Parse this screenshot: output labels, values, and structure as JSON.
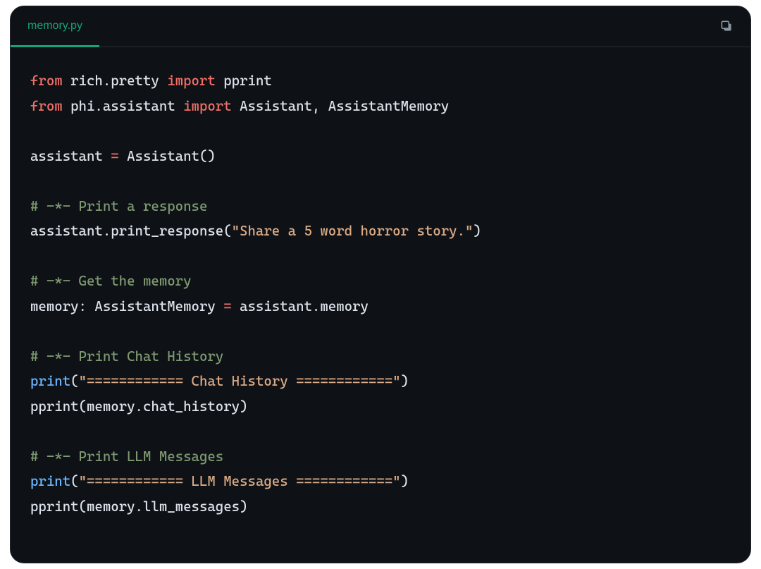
{
  "tab": {
    "filename": "memory.py"
  },
  "icons": {
    "copy": "copy-icon"
  },
  "code": {
    "l1": {
      "kw1": "from",
      "mod": " rich.pretty ",
      "kw2": "import",
      "names": " pprint"
    },
    "l2": {
      "kw1": "from",
      "mod": " phi.assistant ",
      "kw2": "import",
      "names": " Assistant, AssistantMemory"
    },
    "l3": "",
    "l4": {
      "lhs": "assistant ",
      "op": "=",
      "rhs": " Assistant()"
    },
    "l5": "",
    "l6": {
      "cmt": "# -*- Print a response"
    },
    "l7": {
      "call": "assistant.print_response(",
      "str": "\"Share a 5 word horror story.\"",
      "close": ")"
    },
    "l8": "",
    "l9": {
      "cmt": "# -*- Get the memory"
    },
    "l10": {
      "lhs": "memory: AssistantMemory ",
      "op": "=",
      "rhs": " assistant.memory"
    },
    "l11": "",
    "l12": {
      "cmt": "# -*- Print Chat History"
    },
    "l13": {
      "fn": "print",
      "open": "(",
      "str": "\"============ Chat History ============\"",
      "close": ")"
    },
    "l14": {
      "call": "pprint(memory.chat_history)"
    },
    "l15": "",
    "l16": {
      "cmt": "# -*- Print LLM Messages"
    },
    "l17": {
      "fn": "print",
      "open": "(",
      "str": "\"============ LLM Messages ============\"",
      "close": ")"
    },
    "l18": {
      "call": "pprint(memory.llm_messages)"
    }
  }
}
